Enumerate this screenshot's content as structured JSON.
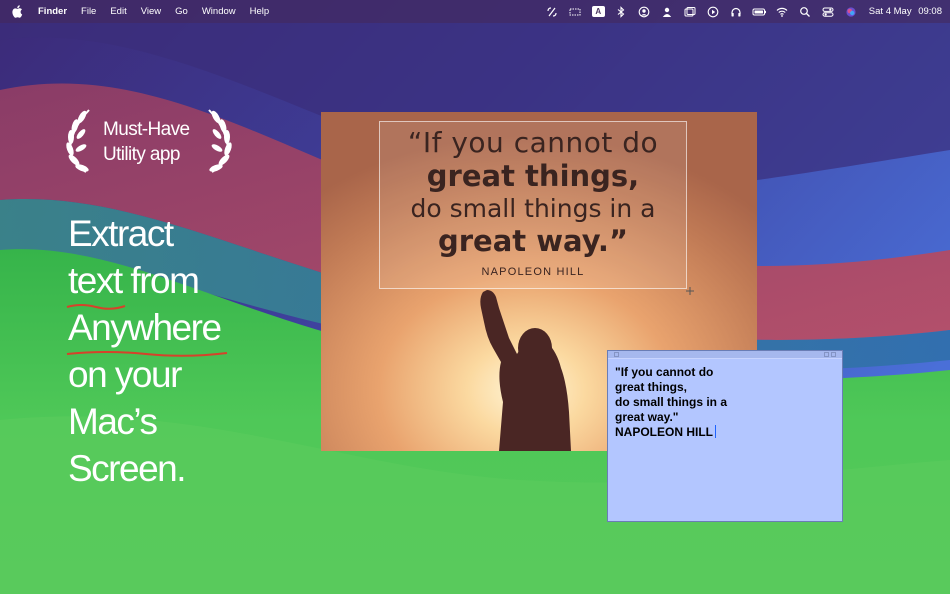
{
  "menubar": {
    "app_name": "Finder",
    "menus": [
      "File",
      "Edit",
      "View",
      "Go",
      "Window",
      "Help"
    ],
    "status_icons": [
      "text-extract-icon",
      "screen-mirror-icon",
      "keyboard-input-icon",
      "bluetooth-icon",
      "account-icon",
      "user-icon",
      "window-icon",
      "play-icon",
      "headphones-icon",
      "battery-icon",
      "wifi-icon",
      "spotlight-search-icon",
      "control-center-icon",
      "siri-icon"
    ],
    "input_badge": "A",
    "date": "Sat 4 May",
    "time": "09:08"
  },
  "promo": {
    "award_line1": "Must-Have",
    "award_line2": "Utility app",
    "headline": {
      "word1": "Extract",
      "word2": "text",
      "word3": "from",
      "word4": "Anywhere",
      "word5": "on your",
      "word6": "Mac’s",
      "word7": "Screen."
    },
    "underline_color": "#d6422a"
  },
  "photo": {
    "quote_line1": "“If you cannot do",
    "quote_line2": "great things,",
    "quote_line3": "do small things in a",
    "quote_line4": "great way.”",
    "author": "NAPOLEON HILL"
  },
  "result_window": {
    "text": "\"If you cannot do\ngreat things,\ndo small things in a\ngreat way.\"\nNAPOLEON HILL",
    "background": "#b3c6ff"
  }
}
